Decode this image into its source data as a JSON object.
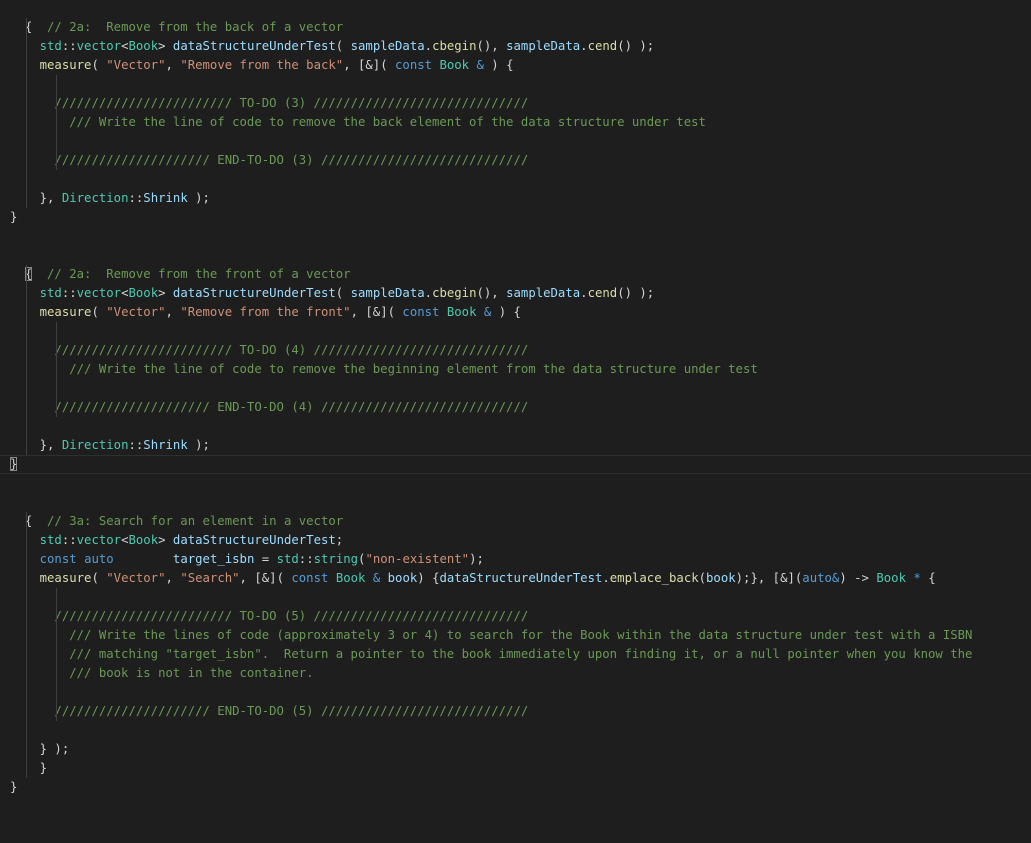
{
  "editor": {
    "indent_guides_at_level": [
      1,
      2
    ],
    "current_line": 23,
    "lines": [
      {
        "indent": 1,
        "tokens": [
          [
            "{",
            "plain"
          ],
          [
            "  ",
            "plain"
          ],
          [
            "// 2a:  Remove from the back of a vector",
            "comment"
          ]
        ]
      },
      {
        "indent": 1,
        "tokens": [
          [
            "  ",
            "plain"
          ],
          [
            "std",
            "ns"
          ],
          [
            "::",
            "op"
          ],
          [
            "vector",
            "type"
          ],
          [
            "<",
            "op"
          ],
          [
            "Book",
            "type"
          ],
          [
            "> ",
            "op"
          ],
          [
            "dataStructureUnderTest",
            "var"
          ],
          [
            "( ",
            "plain"
          ],
          [
            "sampleData",
            "var"
          ],
          [
            ".",
            "op"
          ],
          [
            "cbegin",
            "func"
          ],
          [
            "(), ",
            "plain"
          ],
          [
            "sampleData",
            "var"
          ],
          [
            ".",
            "op"
          ],
          [
            "cend",
            "func"
          ],
          [
            "() );",
            "plain"
          ]
        ]
      },
      {
        "indent": 1,
        "tokens": [
          [
            "  ",
            "plain"
          ],
          [
            "measure",
            "func"
          ],
          [
            "( ",
            "plain"
          ],
          [
            "\"Vector\"",
            "string"
          ],
          [
            ", ",
            "plain"
          ],
          [
            "\"Remove from the back\"",
            "string"
          ],
          [
            ", [&]( ",
            "plain"
          ],
          [
            "const",
            "keyword"
          ],
          [
            " ",
            "plain"
          ],
          [
            "Book",
            "type"
          ],
          [
            " ",
            "plain"
          ],
          [
            "&",
            "keyword"
          ],
          [
            " ) {",
            "plain"
          ]
        ]
      },
      {
        "indent": 2,
        "tokens": []
      },
      {
        "indent": 2,
        "tokens": [
          [
            "    ",
            "plain"
          ],
          [
            "//////////////////////// TO-DO (3) /////////////////////////////",
            "comment"
          ]
        ]
      },
      {
        "indent": 2,
        "tokens": [
          [
            "      ",
            "plain"
          ],
          [
            "/// Write the line of code to remove the back element of the data structure under test",
            "comment"
          ]
        ]
      },
      {
        "indent": 2,
        "tokens": []
      },
      {
        "indent": 2,
        "tokens": [
          [
            "    ",
            "plain"
          ],
          [
            "///////////////////// END-TO-DO (3) ////////////////////////////",
            "comment"
          ]
        ]
      },
      {
        "indent": 1,
        "tokens": []
      },
      {
        "indent": 1,
        "tokens": [
          [
            "  ",
            "plain"
          ],
          [
            "}, ",
            "plain"
          ],
          [
            "Direction",
            "ns"
          ],
          [
            "::",
            "op"
          ],
          [
            "Shrink",
            "var"
          ],
          [
            " );",
            "plain"
          ]
        ]
      },
      {
        "indent": 0,
        "tokens": [
          [
            "}",
            "plain"
          ]
        ]
      },
      {
        "indent": 0,
        "tokens": []
      },
      {
        "indent": 0,
        "tokens": []
      },
      {
        "indent": 1,
        "tokens": [
          [
            "{",
            "match"
          ],
          [
            "  ",
            "plain"
          ],
          [
            "// 2a:  Remove from the front of a vector",
            "comment"
          ]
        ]
      },
      {
        "indent": 1,
        "tokens": [
          [
            "  ",
            "plain"
          ],
          [
            "std",
            "ns"
          ],
          [
            "::",
            "op"
          ],
          [
            "vector",
            "type"
          ],
          [
            "<",
            "op"
          ],
          [
            "Book",
            "type"
          ],
          [
            "> ",
            "op"
          ],
          [
            "dataStructureUnderTest",
            "var"
          ],
          [
            "( ",
            "plain"
          ],
          [
            "sampleData",
            "var"
          ],
          [
            ".",
            "op"
          ],
          [
            "cbegin",
            "func"
          ],
          [
            "(), ",
            "plain"
          ],
          [
            "sampleData",
            "var"
          ],
          [
            ".",
            "op"
          ],
          [
            "cend",
            "func"
          ],
          [
            "() );",
            "plain"
          ]
        ]
      },
      {
        "indent": 1,
        "tokens": [
          [
            "  ",
            "plain"
          ],
          [
            "measure",
            "func"
          ],
          [
            "( ",
            "plain"
          ],
          [
            "\"Vector\"",
            "string"
          ],
          [
            ", ",
            "plain"
          ],
          [
            "\"Remove from the front\"",
            "string"
          ],
          [
            ", [&]( ",
            "plain"
          ],
          [
            "const",
            "keyword"
          ],
          [
            " ",
            "plain"
          ],
          [
            "Book",
            "type"
          ],
          [
            " ",
            "plain"
          ],
          [
            "&",
            "keyword"
          ],
          [
            " ) {",
            "plain"
          ]
        ]
      },
      {
        "indent": 2,
        "tokens": []
      },
      {
        "indent": 2,
        "tokens": [
          [
            "    ",
            "plain"
          ],
          [
            "//////////////////////// TO-DO (4) /////////////////////////////",
            "comment"
          ]
        ]
      },
      {
        "indent": 2,
        "tokens": [
          [
            "      ",
            "plain"
          ],
          [
            "/// Write the line of code to remove the beginning element from the data structure under test",
            "comment"
          ]
        ]
      },
      {
        "indent": 2,
        "tokens": []
      },
      {
        "indent": 2,
        "tokens": [
          [
            "    ",
            "plain"
          ],
          [
            "///////////////////// END-TO-DO (4) ////////////////////////////",
            "comment"
          ]
        ]
      },
      {
        "indent": 1,
        "tokens": []
      },
      {
        "indent": 1,
        "tokens": [
          [
            "  ",
            "plain"
          ],
          [
            "}, ",
            "plain"
          ],
          [
            "Direction",
            "ns"
          ],
          [
            "::",
            "op"
          ],
          [
            "Shrink",
            "var"
          ],
          [
            " );",
            "plain"
          ]
        ]
      },
      {
        "indent": 0,
        "tokens": [
          [
            "}",
            "match"
          ]
        ]
      },
      {
        "indent": 0,
        "tokens": []
      },
      {
        "indent": 0,
        "tokens": []
      },
      {
        "indent": 1,
        "tokens": [
          [
            "{",
            "plain"
          ],
          [
            "  ",
            "plain"
          ],
          [
            "// 3a: Search for an element in a vector",
            "comment"
          ]
        ]
      },
      {
        "indent": 1,
        "tokens": [
          [
            "  ",
            "plain"
          ],
          [
            "std",
            "ns"
          ],
          [
            "::",
            "op"
          ],
          [
            "vector",
            "type"
          ],
          [
            "<",
            "op"
          ],
          [
            "Book",
            "type"
          ],
          [
            "> ",
            "op"
          ],
          [
            "dataStructureUnderTest",
            "var"
          ],
          [
            ";",
            "plain"
          ]
        ]
      },
      {
        "indent": 1,
        "tokens": [
          [
            "  ",
            "plain"
          ],
          [
            "const",
            "keyword"
          ],
          [
            " ",
            "plain"
          ],
          [
            "auto",
            "keyword"
          ],
          [
            "        ",
            "plain"
          ],
          [
            "target_isbn",
            "var"
          ],
          [
            " = ",
            "plain"
          ],
          [
            "std",
            "ns"
          ],
          [
            "::",
            "op"
          ],
          [
            "string",
            "type"
          ],
          [
            "(",
            "plain"
          ],
          [
            "\"non-existent\"",
            "string"
          ],
          [
            ");",
            "plain"
          ]
        ]
      },
      {
        "indent": 1,
        "tokens": [
          [
            "  ",
            "plain"
          ],
          [
            "measure",
            "func"
          ],
          [
            "( ",
            "plain"
          ],
          [
            "\"Vector\"",
            "string"
          ],
          [
            ", ",
            "plain"
          ],
          [
            "\"Search\"",
            "string"
          ],
          [
            ", [&]( ",
            "plain"
          ],
          [
            "const",
            "keyword"
          ],
          [
            " ",
            "plain"
          ],
          [
            "Book",
            "type"
          ],
          [
            " ",
            "plain"
          ],
          [
            "&",
            "keyword"
          ],
          [
            " ",
            "plain"
          ],
          [
            "book",
            "var"
          ],
          [
            ") {",
            "plain"
          ],
          [
            "dataStructureUnderTest",
            "var"
          ],
          [
            ".",
            "op"
          ],
          [
            "emplace_back",
            "func"
          ],
          [
            "(",
            "plain"
          ],
          [
            "book",
            "var"
          ],
          [
            ");}, [&](",
            "plain"
          ],
          [
            "auto&",
            "keyword"
          ],
          [
            ") -> ",
            "plain"
          ],
          [
            "Book",
            "type"
          ],
          [
            " ",
            "plain"
          ],
          [
            "*",
            "keyword"
          ],
          [
            " {",
            "plain"
          ]
        ]
      },
      {
        "indent": 2,
        "tokens": []
      },
      {
        "indent": 2,
        "tokens": [
          [
            "    ",
            "plain"
          ],
          [
            "//////////////////////// TO-DO (5) /////////////////////////////",
            "comment"
          ]
        ]
      },
      {
        "indent": 2,
        "tokens": [
          [
            "      ",
            "plain"
          ],
          [
            "/// Write the lines of code (approximately 3 or 4) to search for the Book within the data structure under test with a ISBN",
            "comment"
          ]
        ]
      },
      {
        "indent": 2,
        "tokens": [
          [
            "      ",
            "plain"
          ],
          [
            "/// matching \"target_isbn\".  Return a pointer to the book immediately upon finding it, or a null pointer when you know the",
            "comment"
          ]
        ]
      },
      {
        "indent": 2,
        "tokens": [
          [
            "      ",
            "plain"
          ],
          [
            "/// book is not in the container.",
            "comment"
          ]
        ]
      },
      {
        "indent": 2,
        "tokens": []
      },
      {
        "indent": 2,
        "tokens": [
          [
            "    ",
            "plain"
          ],
          [
            "///////////////////// END-TO-DO (5) ////////////////////////////",
            "comment"
          ]
        ]
      },
      {
        "indent": 1,
        "tokens": []
      },
      {
        "indent": 1,
        "tokens": [
          [
            "  ",
            "plain"
          ],
          [
            "} );",
            "plain"
          ]
        ]
      },
      {
        "indent": 1,
        "tokens": [
          [
            "  ",
            "plain"
          ],
          [
            "}",
            "plain"
          ]
        ]
      },
      {
        "indent": 0,
        "tokens": [
          [
            "}",
            "plain"
          ]
        ]
      }
    ]
  }
}
